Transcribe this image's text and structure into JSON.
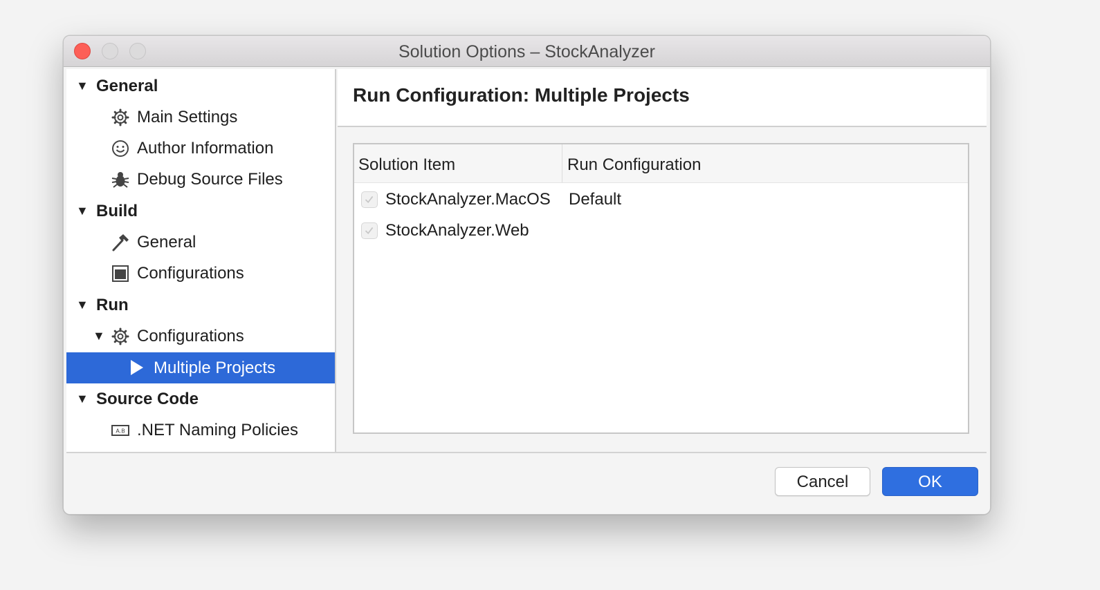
{
  "window": {
    "title": "Solution Options – StockAnalyzer"
  },
  "sidebar": {
    "general": {
      "label": "General",
      "items": [
        "Main Settings",
        "Author Information",
        "Debug Source Files"
      ]
    },
    "build": {
      "label": "Build",
      "items": [
        "General",
        "Configurations"
      ]
    },
    "run": {
      "label": "Run",
      "configurations": "Configurations",
      "selected": "Multiple Projects"
    },
    "source_code": {
      "label": "Source Code",
      "items": [
        ".NET Naming Policies"
      ]
    }
  },
  "content": {
    "title": "Run Configuration: Multiple Projects",
    "columns": [
      "Solution Item",
      "Run Configuration"
    ],
    "rows": [
      {
        "item": "StockAnalyzer.MacOS",
        "config": "Default",
        "checked": true
      },
      {
        "item": "StockAnalyzer.Web",
        "config": "",
        "checked": true
      }
    ]
  },
  "buttons": {
    "cancel": "Cancel",
    "ok": "OK"
  },
  "colors": {
    "selection": "#2d69d8",
    "ok_button": "#2f6fe0",
    "close": "#fd5f57"
  }
}
